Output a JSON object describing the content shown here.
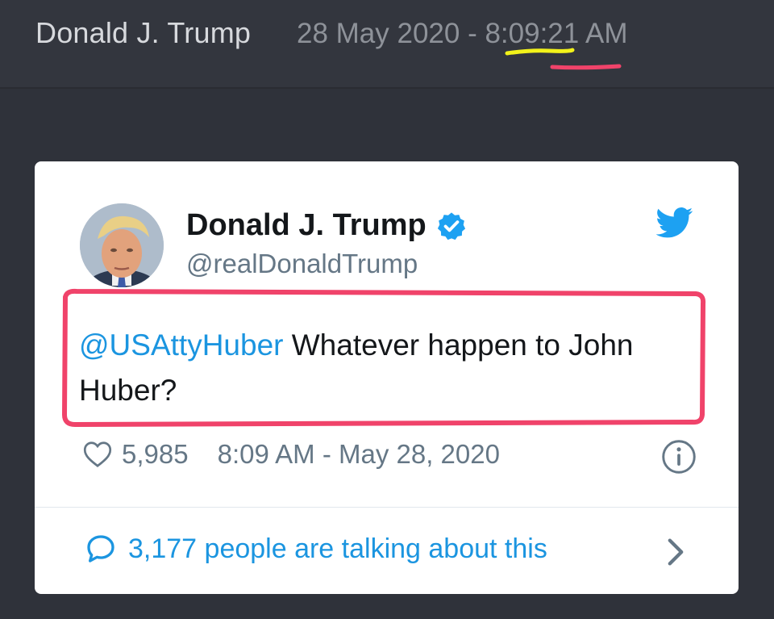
{
  "header": {
    "author": "Donald J. Trump",
    "timestamp": "28 May 2020 - 8:09:21 AM"
  },
  "annotations": {
    "underline_1_color": "#f2f21a",
    "underline_2_color": "#f0436a",
    "box_color": "#f0436a"
  },
  "tweet": {
    "display_name": "Donald J. Trump",
    "handle": "@realDonaldTrump",
    "mention": "@USAttyHuber",
    "text": " Whatever happen to John Huber?",
    "likes": "5,985",
    "posted_at": "8:09 AM - May 28, 2020",
    "talking": "3,177 people are talking about this",
    "icons": {
      "avatar": "profile-photo",
      "verified": "verified-badge-icon",
      "platform": "twitter-bird-icon",
      "like": "heart-icon",
      "info": "info-icon",
      "replies": "speech-bubble-icon",
      "more": "chevron-right-icon"
    },
    "colors": {
      "link": "#1b95e0",
      "text": "#14171a",
      "muted": "#657786",
      "card": "#ffffff",
      "page": "#2f323a"
    }
  }
}
